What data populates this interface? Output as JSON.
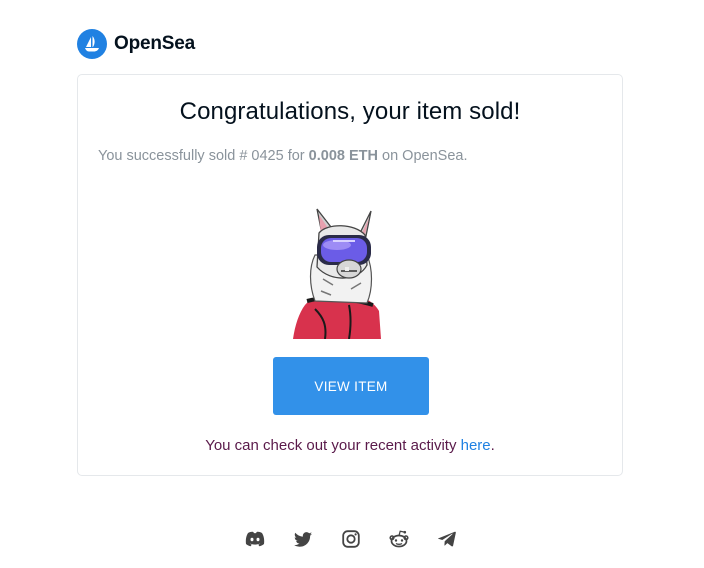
{
  "brand": {
    "name": "OpenSea",
    "color": "#2081e2"
  },
  "card": {
    "title": "Congratulations, your item sold!",
    "summary": {
      "prefix": "You successfully sold # 0425 for ",
      "price": "0.008 ETH",
      "suffix": " on OpenSea."
    },
    "image_alt": "llama-with-ski-goggles-nft",
    "button_label": "VIEW ITEM",
    "activity": {
      "prefix": "You can check out your recent activity ",
      "link": "here",
      "suffix": "."
    }
  },
  "footer": {
    "socials": [
      "discord-icon",
      "twitter-icon",
      "instagram-icon",
      "reddit-icon",
      "telegram-icon"
    ]
  },
  "colors": {
    "button": "#3291e9",
    "text_muted": "#8a939b",
    "link": "#2081e2"
  }
}
